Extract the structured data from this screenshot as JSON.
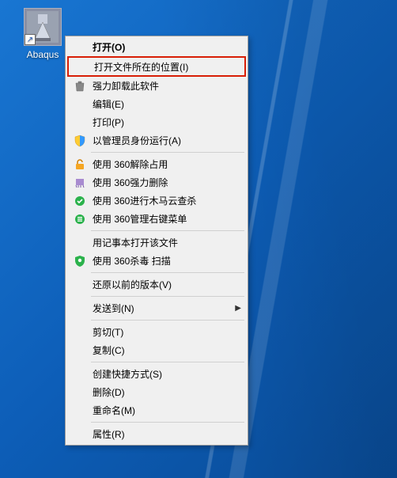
{
  "desktop": {
    "shortcut_label": "Abaqus",
    "shortcut_arrow": "↗"
  },
  "menu": {
    "open": "打开(O)",
    "open_location": "打开文件所在的位置(I)",
    "force_uninstall": "强力卸载此软件",
    "edit": "编辑(E)",
    "print": "打印(P)",
    "run_as_admin": "以管理员身份运行(A)",
    "sep1": "",
    "use_360_unlock": "使用 360解除占用",
    "use_360_force_delete": "使用 360强力删除",
    "use_360_scan_trojan": "使用 360进行木马云查杀",
    "use_360_manage_context": "使用 360管理右键菜单",
    "sep2": "",
    "open_notepad": "用记事本打开该文件",
    "use_360_scan_virus": "使用 360杀毒 扫描",
    "sep3": "",
    "restore_previous": "还原以前的版本(V)",
    "sep4": "",
    "send_to": "发送到(N)",
    "sep5": "",
    "cut": "剪切(T)",
    "copy": "复制(C)",
    "sep6": "",
    "create_shortcut": "创建快捷方式(S)",
    "delete": "删除(D)",
    "rename": "重命名(M)",
    "sep7": "",
    "properties": "属性(R)"
  }
}
